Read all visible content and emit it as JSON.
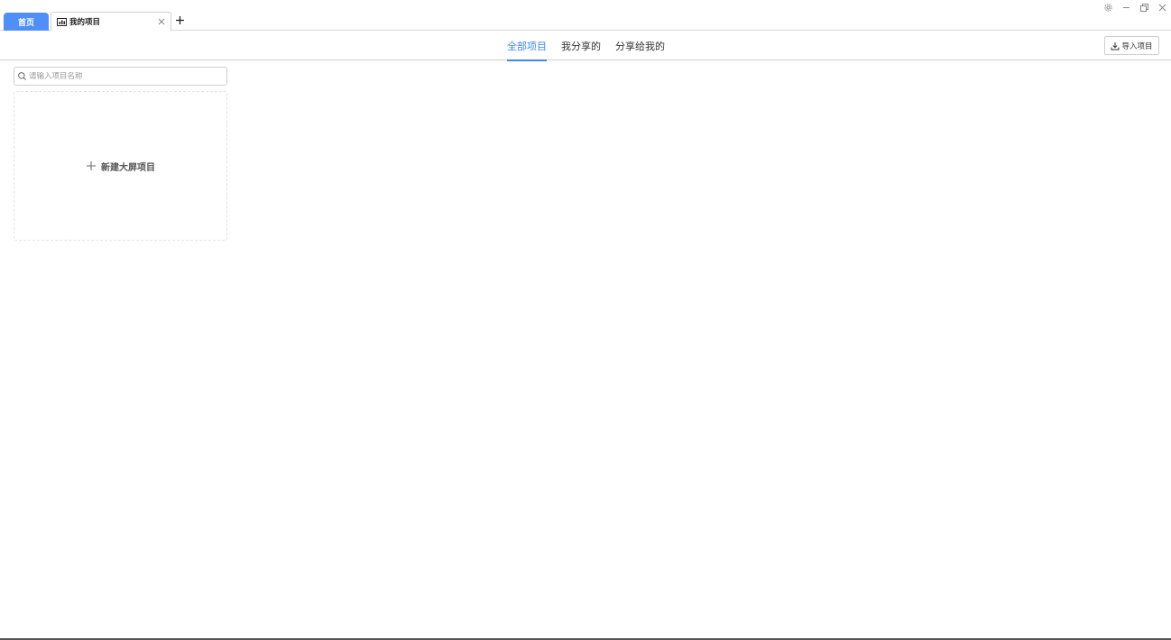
{
  "tabs": {
    "home_label": "首页",
    "active_label": "我的项目",
    "active_icon": "dashboard-icon",
    "close_icon": "close-icon",
    "add_icon": "plus-icon"
  },
  "window_controls": [
    "gear-icon",
    "minimize-icon",
    "restore-icon",
    "close-icon"
  ],
  "subnav": {
    "tabs": [
      {
        "label": "全部项目",
        "active": true
      },
      {
        "label": "我分享的",
        "active": false
      },
      {
        "label": "分享给我的",
        "active": false
      }
    ],
    "import_label": "导入项目",
    "import_icon": "download-icon"
  },
  "search": {
    "placeholder": "请输入项目名称",
    "value": ""
  },
  "new_card": {
    "label": "新建大屏项目",
    "icon": "plus-icon"
  },
  "colors": {
    "accent": "#3f86f2",
    "home_tab": "#4f8ff7"
  }
}
